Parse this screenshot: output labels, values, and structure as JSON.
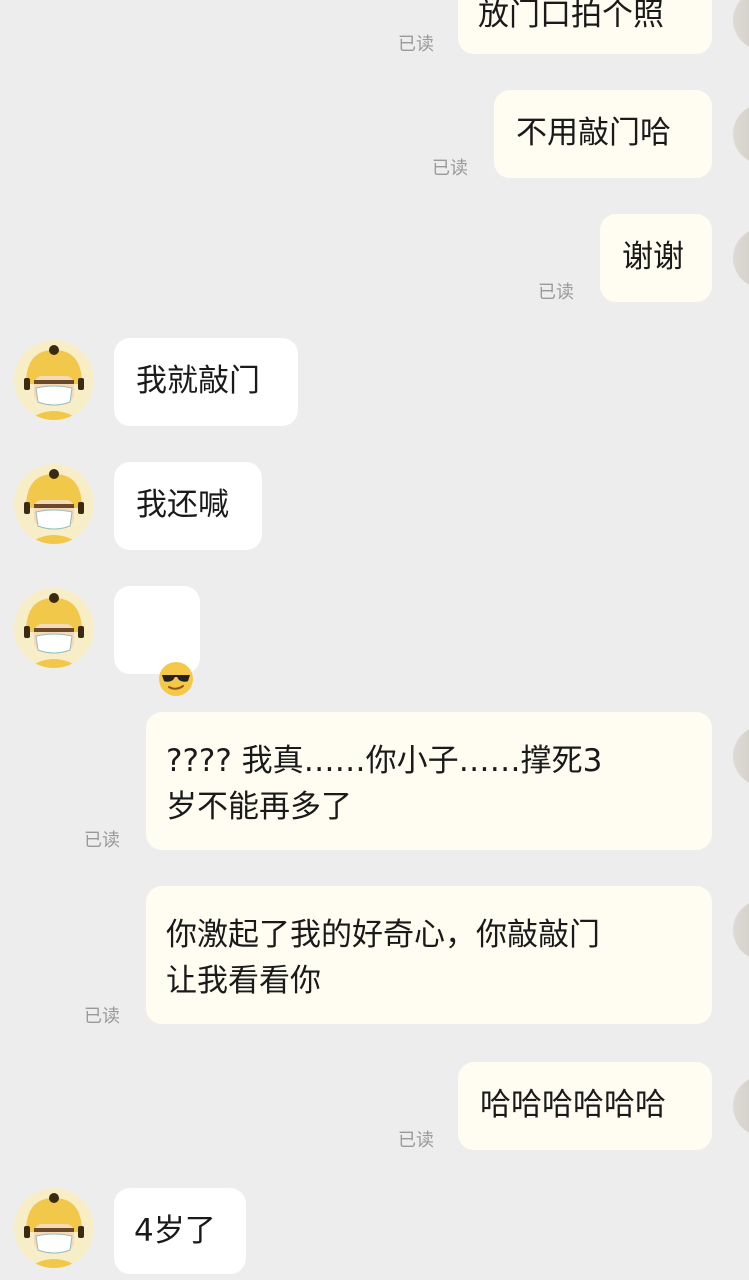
{
  "read_label": "已读",
  "messages": [
    {
      "dir": "out",
      "text": "放门口拍个照"
    },
    {
      "dir": "out",
      "text": "不用敲门哈"
    },
    {
      "dir": "out",
      "text": "谢谢"
    },
    {
      "dir": "in",
      "text": "我就敲门"
    },
    {
      "dir": "in",
      "text": "我还喊"
    },
    {
      "dir": "in",
      "icon": "sunglasses-emoji-icon"
    },
    {
      "dir": "out",
      "text": "???? 我真……你小子……撑死3\n岁不能再多了"
    },
    {
      "dir": "out",
      "text": "你激起了我的好奇心，你敲敲门\n让我看看你"
    },
    {
      "dir": "out",
      "text": "哈哈哈哈哈哈"
    },
    {
      "dir": "in",
      "text": "4岁了"
    }
  ],
  "colors": {
    "background": "#ededed",
    "incoming_bubble": "#ffffff",
    "outgoing_bubble": "#fffdf2",
    "read_text": "#9a9a9a",
    "avatar_bg": "#f7eec8",
    "avatar_helmet": "#f2c84b"
  }
}
